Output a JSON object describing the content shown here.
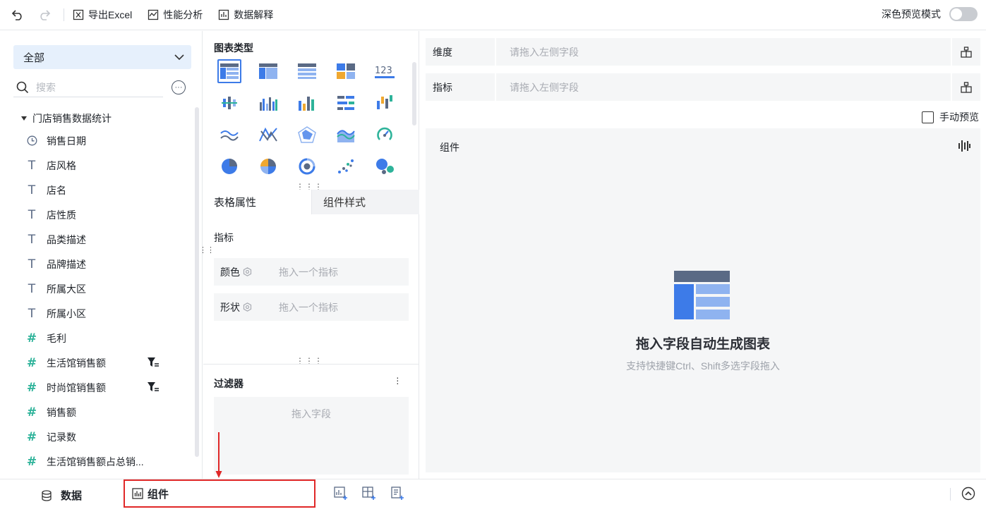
{
  "toolbar": {
    "undo_icon": "undo-icon",
    "redo_icon": "redo-icon",
    "export_excel": "导出Excel",
    "performance": "性能分析",
    "data_explain": "数据解释",
    "dark_preview": "深色预览模式"
  },
  "left": {
    "select_value": "全部",
    "search_placeholder": "搜索",
    "tree_root": "门店销售数据统计",
    "fields": [
      {
        "label": "销售日期",
        "type": "date"
      },
      {
        "label": "店风格",
        "type": "text"
      },
      {
        "label": "店名",
        "type": "text"
      },
      {
        "label": "店性质",
        "type": "text"
      },
      {
        "label": "品类描述",
        "type": "text"
      },
      {
        "label": "品牌描述",
        "type": "text"
      },
      {
        "label": "所属大区",
        "type": "text"
      },
      {
        "label": "所属小区",
        "type": "text"
      },
      {
        "label": "毛利",
        "type": "number"
      },
      {
        "label": "生活馆销售额",
        "type": "number",
        "filter": true
      },
      {
        "label": "时尚馆销售额",
        "type": "number",
        "filter": true
      },
      {
        "label": "销售额",
        "type": "number"
      },
      {
        "label": "记录数",
        "type": "number"
      },
      {
        "label": "生活馆销售额占总销...",
        "type": "calc"
      }
    ]
  },
  "middle": {
    "chart_type_title": "图表类型",
    "tab_table_props": "表格属性",
    "tab_component_style": "组件样式",
    "metric_label": "指标",
    "color_label": "颜色",
    "color_placeholder": "拖入一个指标",
    "shape_label": "形状",
    "shape_placeholder": "拖入一个指标",
    "filter_title": "过滤器",
    "filter_placeholder": "拖入字段"
  },
  "right": {
    "dimension_label": "维度",
    "dimension_placeholder": "请拖入左侧字段",
    "metric_label": "指标",
    "metric_placeholder": "请拖入左侧字段",
    "manual_preview": "手动预览",
    "canvas_title": "组件",
    "empty_title": "拖入字段自动生成图表",
    "empty_sub": "支持快捷键Ctrl、Shift多选字段拖入"
  },
  "bottom": {
    "data_tab": "数据",
    "component_tab": "组件"
  },
  "colors": {
    "accent": "#3d7be8",
    "highlight_border": "#e02828",
    "number_icon": "#2eb39a"
  }
}
